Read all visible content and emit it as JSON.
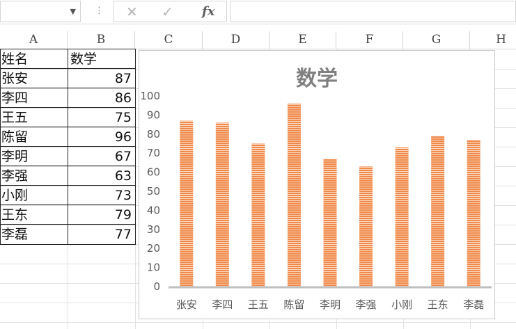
{
  "formula_bar": {
    "name_box_value": "",
    "dropdown_icon": "chevron-down-icon",
    "more_icon": "vertical-dots-icon",
    "cancel_glyph": "✕",
    "enter_glyph": "✓",
    "fx_label": "fx",
    "formula_value": ""
  },
  "columns": [
    "A",
    "B",
    "C",
    "D",
    "E",
    "F",
    "G",
    "H"
  ],
  "table": {
    "header": {
      "name": "姓名",
      "score": "数学"
    },
    "rows": [
      {
        "name": "张安",
        "score": "87"
      },
      {
        "name": "李四",
        "score": "86"
      },
      {
        "name": "王五",
        "score": "75"
      },
      {
        "name": "陈留",
        "score": "96"
      },
      {
        "name": "李明",
        "score": "67"
      },
      {
        "name": "李强",
        "score": "63"
      },
      {
        "name": "小刚",
        "score": "73"
      },
      {
        "name": "王东",
        "score": "79"
      },
      {
        "name": "李磊",
        "score": "77"
      }
    ]
  },
  "chart_data": {
    "type": "bar",
    "title": "数学",
    "categories": [
      "张安",
      "李四",
      "王五",
      "陈留",
      "李明",
      "李强",
      "小刚",
      "王东",
      "李磊"
    ],
    "values": [
      87,
      86,
      75,
      96,
      67,
      63,
      73,
      79,
      77
    ],
    "ylim": [
      0,
      100
    ],
    "yticks": [
      "0",
      "10",
      "20",
      "30",
      "40",
      "50",
      "60",
      "70",
      "80",
      "90",
      "100"
    ],
    "xlabel": "",
    "ylabel": "",
    "grid": false,
    "legend": "none",
    "colors": {
      "bar": "#f08a4b",
      "bar_stripe": "#fbd9c2",
      "title": "#808080",
      "axis": "#bfbfbf",
      "label": "#595959"
    }
  }
}
